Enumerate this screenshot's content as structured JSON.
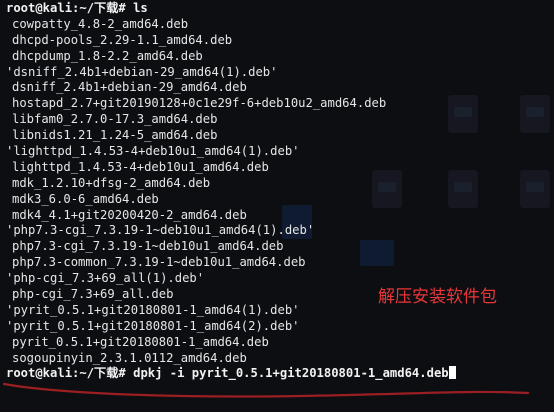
{
  "terminal": {
    "prompt1": "root@kali:~/下载# ls",
    "files": [
      {
        "text": "cowpatty_4.8-2_amd64.deb",
        "quoted": false
      },
      {
        "text": "dhcpd-pools_2.29-1.1_amd64.deb",
        "quoted": false
      },
      {
        "text": "dhcpdump_1.8-2.2_amd64.deb",
        "quoted": false
      },
      {
        "text": "'dsniff_2.4b1+debian-29_amd64(1).deb'",
        "quoted": true
      },
      {
        "text": "dsniff_2.4b1+debian-29_amd64.deb",
        "quoted": false
      },
      {
        "text": "hostapd_2.7+git20190128+0c1e29f-6+deb10u2_amd64.deb",
        "quoted": false
      },
      {
        "text": "libfam0_2.7.0-17.3_amd64.deb",
        "quoted": false
      },
      {
        "text": "libnids1.21_1.24-5_amd64.deb",
        "quoted": false
      },
      {
        "text": "'lighttpd_1.4.53-4+deb10u1_amd64(1).deb'",
        "quoted": true
      },
      {
        "text": "lighttpd_1.4.53-4+deb10u1_amd64.deb",
        "quoted": false
      },
      {
        "text": "mdk_1.2.10+dfsg-2_amd64.deb",
        "quoted": false
      },
      {
        "text": "mdk3_6.0-6_amd64.deb",
        "quoted": false
      },
      {
        "text": "mdk4_4.1+git20200420-2_amd64.deb",
        "quoted": false
      },
      {
        "text": "'php7.3-cgi_7.3.19-1~deb10u1_amd64(1).deb'",
        "quoted": true
      },
      {
        "text": "php7.3-cgi_7.3.19-1~deb10u1_amd64.deb",
        "quoted": false
      },
      {
        "text": "php7.3-common_7.3.19-1~deb10u1_amd64.deb",
        "quoted": false
      },
      {
        "text": "'php-cgi_7.3+69_all(1).deb'",
        "quoted": true
      },
      {
        "text": "php-cgi_7.3+69_all.deb",
        "quoted": false
      },
      {
        "text": "'pyrit_0.5.1+git20180801-1_amd64(1).deb'",
        "quoted": true
      },
      {
        "text": "'pyrit_0.5.1+git20180801-1_amd64(2).deb'",
        "quoted": true
      },
      {
        "text": "pyrit_0.5.1+git20180801-1_amd64.deb",
        "quoted": false
      },
      {
        "text": "sogoupinyin_2.3.1.0112_amd64.deb",
        "quoted": false
      }
    ],
    "prompt2": "root@kali:~/下载#",
    "command": " dpkj -i pyrit_0.5.1+git20180801-1_amd64.deb"
  },
  "annotation": {
    "text": "解压安装软件包",
    "color": "#e8363a"
  }
}
